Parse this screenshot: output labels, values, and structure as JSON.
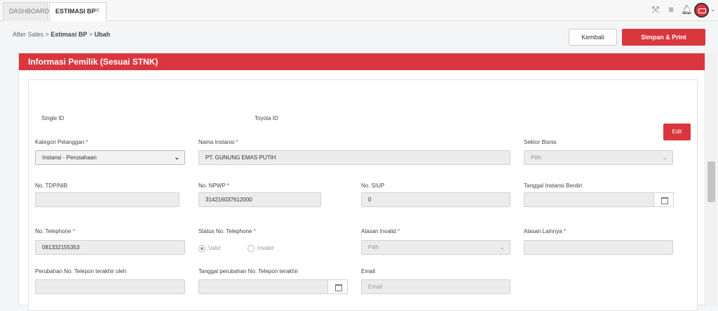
{
  "tabs": [
    {
      "label": "DASHBOARD"
    },
    {
      "label": "ESTIMASI BP",
      "close": "✕"
    }
  ],
  "breadcrumb": {
    "root": "After Sales",
    "sep": ">",
    "middle": "Estimasi BP",
    "current": "Ubah"
  },
  "actions": {
    "back": "Kembali",
    "save_print": "Simpan & Print"
  },
  "section": {
    "title": "Informasi Pemilik (Sesuai STNK)"
  },
  "ids": {
    "single_id": "Single ID",
    "toyota_id": "Toyota ID"
  },
  "edit_button": "Edit",
  "required_mark": "*",
  "fields": {
    "kategori": {
      "label": "Kategori Pelanggan",
      "value": "Instansi - Perusahaan"
    },
    "nama_instansi": {
      "label": "Nama Instansi",
      "value": "PT. GUNUNG EMAS PUTIH"
    },
    "sektor_bisnis": {
      "label": "Sektor Bisnis",
      "value": "Pilih"
    },
    "tdp": {
      "label": "No. TDP/NIB",
      "value": ""
    },
    "npwp": {
      "label": "No. NPWP",
      "value": "314216037612000"
    },
    "siup": {
      "label": "No. SIUP",
      "value": "0"
    },
    "tanggal_berdiri": {
      "label": "Tanggal Instansi Berdiri",
      "value": ""
    },
    "telephone": {
      "label": "No. Telephone",
      "value": "081332155353"
    },
    "status_telephone": {
      "label": "Status No. Telephone",
      "options": [
        "Valid",
        "Invalid"
      ],
      "selected": "Valid"
    },
    "alasan_invalid": {
      "label": "Alasan Invalid",
      "value": "Pilih"
    },
    "alasan_lainnya": {
      "label": "Alasan Lainnya",
      "value": ""
    },
    "perubahan_oleh": {
      "label": "Perubahan No. Telepon terakhir oleh",
      "value": ""
    },
    "tanggal_perubahan": {
      "label": "Tanggal perubahan No. Telepon terakhir",
      "value": ""
    },
    "email": {
      "label": "Email",
      "placeholder": "Email"
    }
  }
}
